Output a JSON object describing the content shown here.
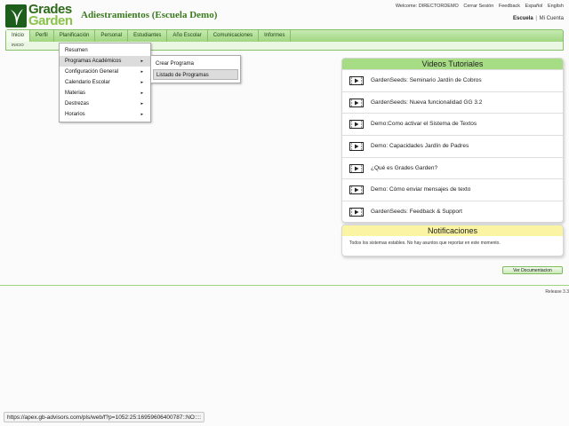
{
  "brand": {
    "line1": "Grades",
    "line2": "Garden"
  },
  "app_title": "Adiestramientos (Escuela Demo)",
  "top_links": {
    "welcome": "Welcome: DIRECTORDEMO",
    "logout": "Cerrar Sesión",
    "feedback": "Feedback",
    "spanish": "Español",
    "english": "English"
  },
  "school_line": {
    "school": "Escuela",
    "separator": "|",
    "mine": "Mi Cuenta"
  },
  "menu": [
    {
      "label": "Inicio"
    },
    {
      "label": "Perfil"
    },
    {
      "label": "Planificación"
    },
    {
      "label": "Personal"
    },
    {
      "label": "Estudiantes"
    },
    {
      "label": "Año Escolar"
    },
    {
      "label": "Comunicaciones"
    },
    {
      "label": "Informes"
    }
  ],
  "breadcrumb": "INICIO",
  "dropdown": [
    {
      "label": "Resumen",
      "arrow": ""
    },
    {
      "label": "Programas Académicos",
      "arrow": "▸"
    },
    {
      "label": "Configuración General",
      "arrow": "▸"
    },
    {
      "label": "Calendario Escolar",
      "arrow": "▸"
    },
    {
      "label": "Materias",
      "arrow": "▸"
    },
    {
      "label": "Destrezas",
      "arrow": "▸"
    },
    {
      "label": "Horarios",
      "arrow": "▸"
    }
  ],
  "flyout": [
    {
      "label": "Crear Programa"
    },
    {
      "label": "Listado de Programas"
    }
  ],
  "videos": {
    "title": "Videos Tutoriales",
    "items": [
      {
        "label": "GardenSeeds: Seminario Jardín de Cobros",
        "icon": "video-icon"
      },
      {
        "label": "GardenSeeds: Nueva funcionalidad GG 3.2",
        "icon": "video-icon"
      },
      {
        "label": "Demo:Como activar el Sistema de Textos",
        "icon": "video-icon"
      },
      {
        "label": "Demo: Capacidades Jardín de Padres",
        "icon": "video-icon"
      },
      {
        "label": "¿Qué es Grades Garden?",
        "icon": "video-icon"
      },
      {
        "label": "Demo: Cómo enviar mensajes de texto",
        "icon": "video-icon"
      },
      {
        "label": "GardenSeeds: Feedback & Support",
        "icon": "video-icon"
      }
    ]
  },
  "notifications": {
    "title": "Notificaciones",
    "message": "Todos los sistemas estables. No hay asuntos que reportar en este momento."
  },
  "doc_button": "Ver Documentacion",
  "release": "Release 3.3",
  "status_url": "https://apex.gb-advisors.com/pls/web/f?p=1052:25:16959606400787::NO::::",
  "colors": {
    "menu_green": "#a6dc84",
    "brand_dark": "#2f6b1c",
    "brand_light": "#8bc34a",
    "notif_yellow": "#fbf5a3"
  }
}
